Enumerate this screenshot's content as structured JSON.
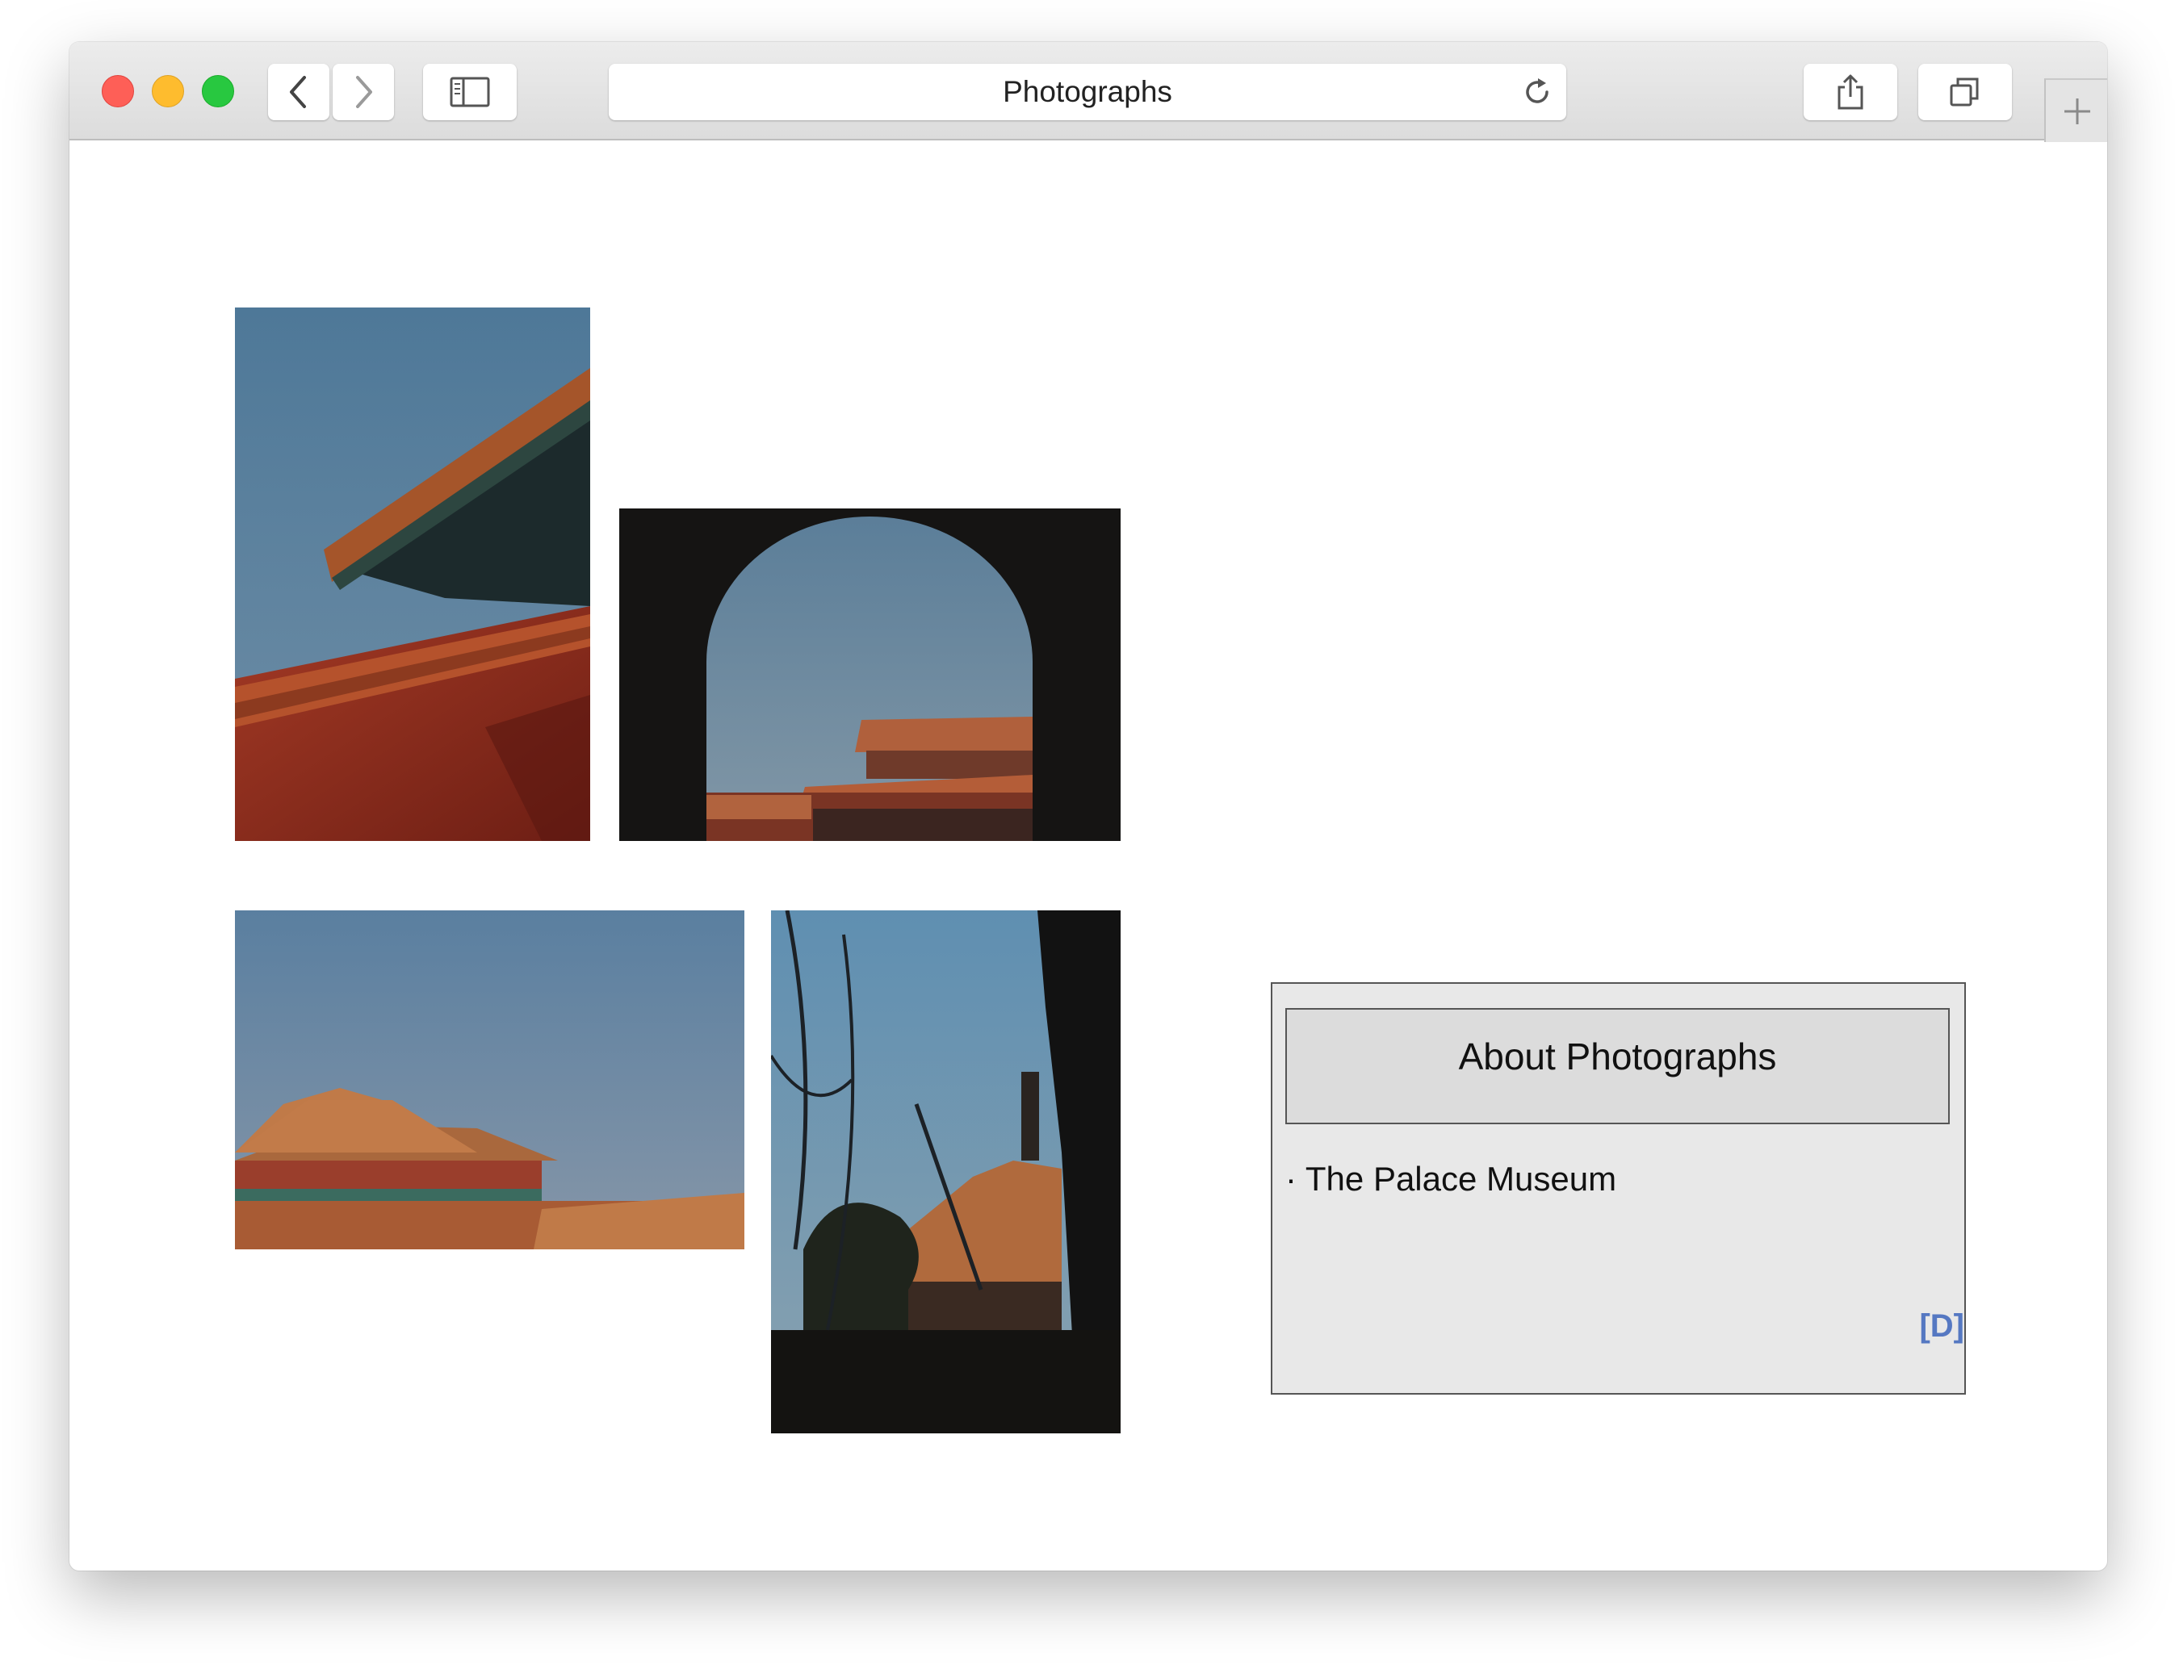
{
  "browser": {
    "title": "Photographs",
    "icons": {
      "back": "chevron-left-icon",
      "forward": "chevron-right-icon",
      "sidebar": "sidebar-icon",
      "reload": "reload-icon",
      "share": "share-icon",
      "tabs": "tabs-icon",
      "new_tab": "plus-icon"
    },
    "colors": {
      "close": "#fe5f57",
      "minimize": "#febc2e",
      "zoom": "#28c840"
    }
  },
  "gallery": {
    "photos": [
      {
        "subject": "red-wall-and-eaves"
      },
      {
        "subject": "archway-framing-pavilion"
      },
      {
        "subject": "palace-hall-roof-under-sky"
      },
      {
        "subject": "pavilion-silhouette-with-branches"
      }
    ]
  },
  "about": {
    "heading": "About Photographs",
    "items": [
      "· The Palace Museum"
    ],
    "link_label": "[D]",
    "link_color": "#5578c2"
  }
}
